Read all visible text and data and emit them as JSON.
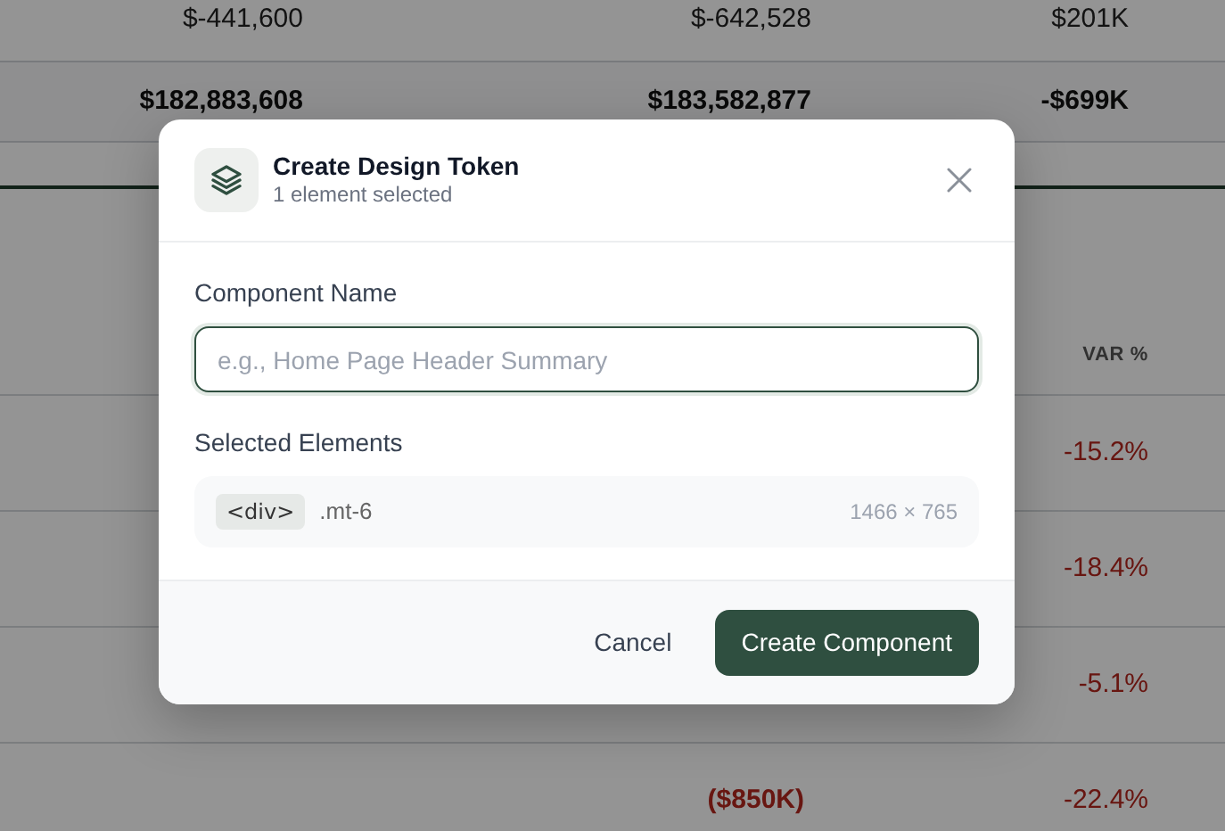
{
  "background_table": {
    "top_rows": [
      {
        "kind": "plain",
        "cells": [
          "$-441,600",
          "$-642,528",
          "$201K"
        ]
      },
      {
        "kind": "total",
        "cells": [
          "$182,883,608",
          "$183,582,877",
          "-$699K"
        ]
      }
    ]
  },
  "variance_table": {
    "header": {
      "column_4": "VAR %"
    },
    "rows": [
      {
        "var_pct": "-15.2%"
      },
      {
        "var_pct": "-18.4%"
      },
      {
        "var_pct": "-5.1%"
      },
      {
        "column_3": "($850K)",
        "var_pct": "-22.4%"
      }
    ]
  },
  "dialog": {
    "title": "Create Design Token",
    "subtitle": "1 element selected",
    "name_label": "Component Name",
    "name_placeholder": "e.g., Home Page Header Summary",
    "elements_label": "Selected Elements",
    "elements": [
      {
        "tag": "<div>",
        "class_name": ".mt-6",
        "size": "1466 × 765"
      }
    ],
    "buttons": [
      {
        "kind": "secondary",
        "label": "Cancel"
      },
      {
        "kind": "primary",
        "label": "Create Component"
      }
    ]
  }
}
